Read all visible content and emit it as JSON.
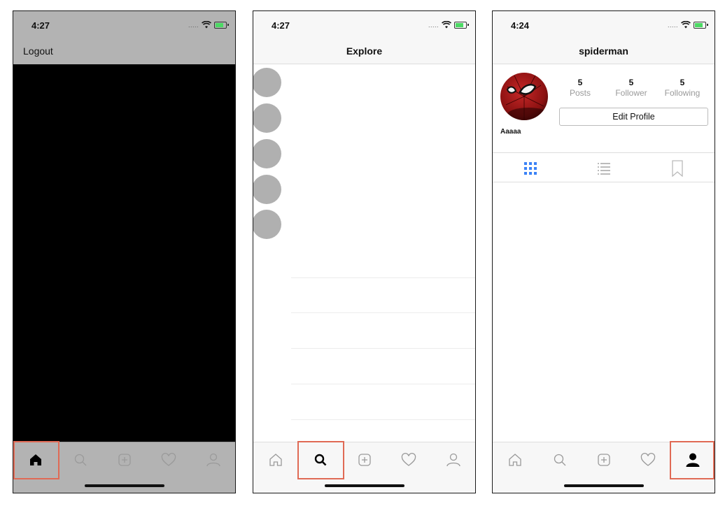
{
  "screens": [
    {
      "time": "4:27",
      "nav_left": "Logout",
      "active_tab": "home"
    },
    {
      "time": "4:27",
      "title": "Explore",
      "active_tab": "search",
      "placeholders": 5
    },
    {
      "time": "4:24",
      "title": "spiderman",
      "active_tab": "profile",
      "stats": [
        {
          "value": "5",
          "label": "Posts"
        },
        {
          "value": "5",
          "label": "Follower"
        },
        {
          "value": "5",
          "label": "Following"
        }
      ],
      "edit_button": "Edit Profile",
      "display_name": "Aaaaa",
      "profile_tabs": [
        "grid-icon",
        "list-icon",
        "bookmark-icon"
      ]
    }
  ],
  "tabs": [
    "home-icon",
    "search-icon",
    "add-icon",
    "heart-icon",
    "profile-icon"
  ],
  "colors": {
    "highlight": "#e06a55",
    "active_profile_tab": "#3b82f6",
    "inactive_icon": "#9a9a9a",
    "placeholder": "#b0b0b0",
    "status_bar_gray": "#b3b3b3"
  }
}
